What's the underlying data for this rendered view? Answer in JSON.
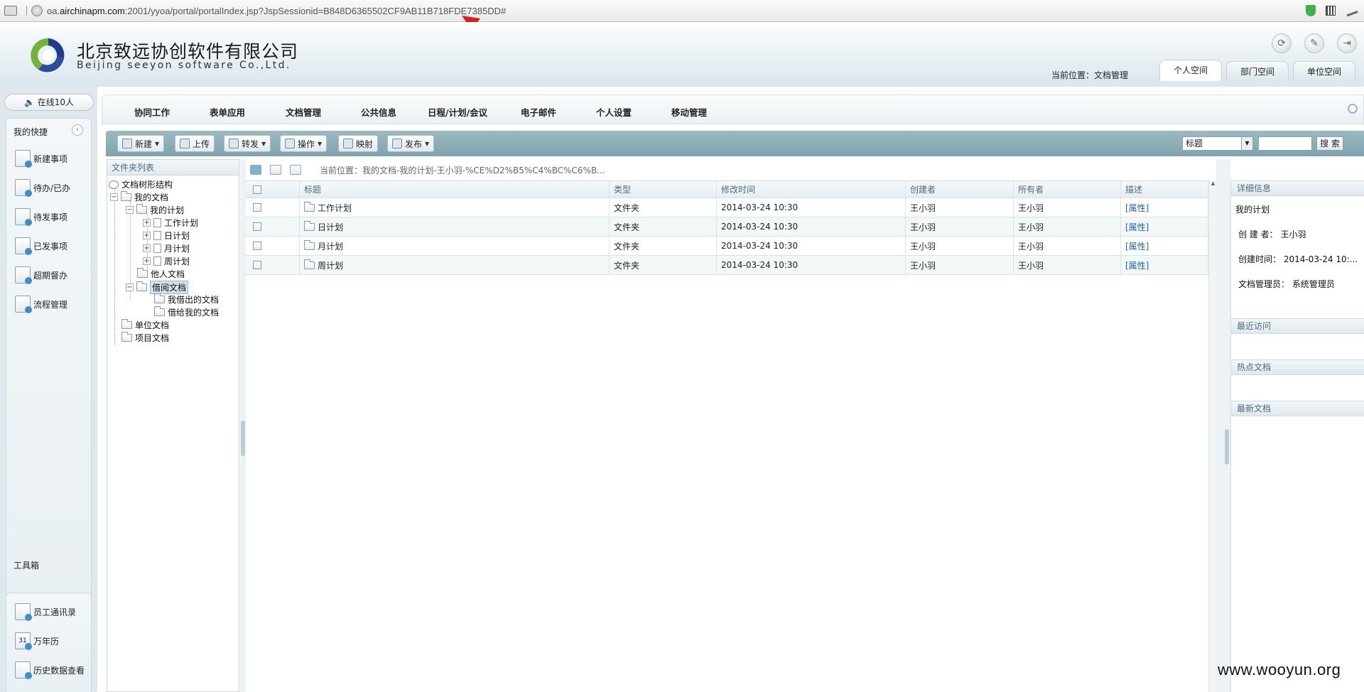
{
  "browser": {
    "url_prefix": "oa.",
    "url_host": "airchinapm.com",
    "url_rest": ":2001/yyoa/portal/portalIndex.jsp?JspSessionid=B848D6365502CF9AB11B718FDE7385DD#"
  },
  "header": {
    "company_cn": "北京致远协创软件有限公司",
    "company_en": "Beijing seeyon software Co.,Ltd.",
    "current_position": "当前位置：文档管理",
    "tabs": [
      {
        "label": "个人空间",
        "active": true
      },
      {
        "label": "部门空间",
        "active": false
      },
      {
        "label": "单位空间",
        "active": false
      }
    ],
    "icons": [
      "refresh-icon",
      "tools-icon",
      "logout-icon"
    ]
  },
  "sidebar": {
    "online": "在线10人",
    "quick_title": "我的快捷",
    "quick_items": [
      "新建事项",
      "待办/已办",
      "待发事项",
      "已发事项",
      "超期督办",
      "流程管理"
    ],
    "toolbox_title": "工具箱",
    "toolbox_items": [
      "员工通讯录",
      "万年历",
      "历史数据查看"
    ],
    "calendar_day": "31"
  },
  "menu": [
    "协同工作",
    "表单应用",
    "文档管理",
    "公共信息",
    "日程/计划/会议",
    "电子邮件",
    "个人设置",
    "移动管理"
  ],
  "toolbar": {
    "buttons": [
      "新建",
      "上传",
      "转发",
      "操作",
      "映射",
      "发布"
    ],
    "search_field": "标题",
    "search_button": "搜 索"
  },
  "tree": {
    "header": "文件夹列表",
    "root": "文档树形结构",
    "nodes": [
      "我的文档",
      "我的计划",
      "工作计划",
      "日计划",
      "月计划",
      "周计划",
      "他人文档",
      "借阅文档",
      "我借出的文档",
      "借给我的文档",
      "单位文档",
      "项目文档"
    ]
  },
  "main": {
    "path": "当前位置：我的文档-我的计划-王小羽-%CE%D2%B5%C4%BC%C6%B...",
    "columns": [
      "标题",
      "类型",
      "修改时间",
      "创建者",
      "所有者",
      "描述"
    ],
    "rows": [
      {
        "title": "工作计划",
        "type": "文件夹",
        "modified": "2014-03-24 10:30",
        "creator": "王小羽",
        "owner": "王小羽",
        "desc": "[属性]"
      },
      {
        "title": "日计划",
        "type": "文件夹",
        "modified": "2014-03-24 10:30",
        "creator": "王小羽",
        "owner": "王小羽",
        "desc": "[属性]"
      },
      {
        "title": "月计划",
        "type": "文件夹",
        "modified": "2014-03-24 10:30",
        "creator": "王小羽",
        "owner": "王小羽",
        "desc": "[属性]"
      },
      {
        "title": "周计划",
        "type": "文件夹",
        "modified": "2014-03-24 10:30",
        "creator": "王小羽",
        "owner": "王小羽",
        "desc": "[属性]"
      }
    ]
  },
  "details": {
    "title": "详细信息",
    "name": "我的计划",
    "creator": "创 建 者：  王小羽",
    "created": "创建时间：  2014-03-24 10:...",
    "admin": "文档管理员：  系统管理员",
    "recent": "最近访问",
    "hot": "热点文档",
    "newest": "最新文档"
  },
  "watermark": "www.wooyun.org",
  "colors": {
    "toolbar": "#8fb0ba",
    "link": "#1e62b7",
    "annotation_arrow": "#e8191c"
  }
}
